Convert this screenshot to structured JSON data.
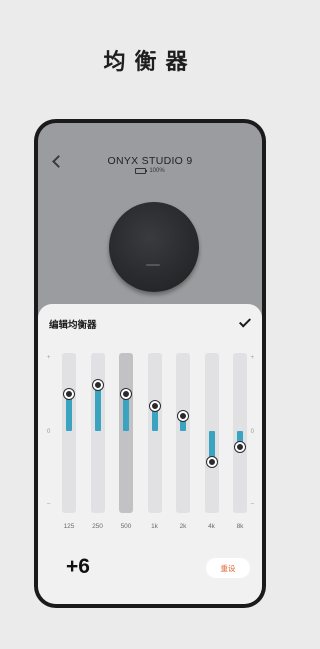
{
  "headline": "均衡器",
  "device": {
    "name": "ONYX STUDIO 9",
    "battery": "100%"
  },
  "sheet": {
    "title": "编辑均衡器",
    "gain": "+6",
    "reset_label": "重设"
  },
  "scale_labels": {
    "top": "+",
    "middle": "0",
    "bottom": "–"
  },
  "bands": [
    {
      "label": "125",
      "value": 0.6,
      "selected": false
    },
    {
      "label": "250",
      "value": 0.75,
      "selected": false
    },
    {
      "label": "500",
      "value": 0.6,
      "selected": true
    },
    {
      "label": "1k",
      "value": 0.4,
      "selected": false
    },
    {
      "label": "2k",
      "value": 0.25,
      "selected": false
    },
    {
      "label": "4k",
      "value": -0.5,
      "selected": false
    },
    {
      "label": "8k",
      "value": -0.25,
      "selected": false
    }
  ],
  "colors": {
    "accent_bar": "#3aa3c0",
    "reset_text": "#e26a3b"
  }
}
